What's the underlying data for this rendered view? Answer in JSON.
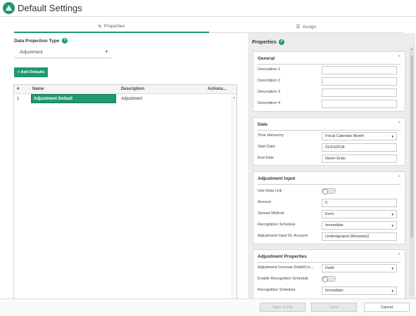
{
  "app": {
    "title": "Default Settings"
  },
  "tabs": [
    {
      "label": "Properties",
      "icon": "pencil-icon",
      "active": true
    },
    {
      "label": "Assign",
      "icon": "list-icon",
      "active": false
    }
  ],
  "projection": {
    "label": "Data Projection Type",
    "selected": "Adjustment"
  },
  "add_defaults_label": "+ Add Defaults",
  "grid": {
    "headers": [
      "#",
      "Name",
      "Description",
      "Actions..."
    ],
    "rows": [
      {
        "num": "1",
        "name": "Adjustment Default",
        "description": "Adjustment",
        "actions": ""
      }
    ]
  },
  "properties": {
    "title": "Properties",
    "general": {
      "title": "General",
      "fields": [
        {
          "label": "Description 1",
          "value": ""
        },
        {
          "label": "Description 2",
          "value": ""
        },
        {
          "label": "Description 3",
          "value": ""
        },
        {
          "label": "Description 4",
          "value": ""
        }
      ]
    },
    "date": {
      "title": "Date",
      "time_hierarchy": {
        "label": "Time Hierarchy",
        "value": "Fiscal Calendar Month"
      },
      "start_date": {
        "label": "Start Date",
        "value": "01/01/2018"
      },
      "end_date": {
        "label": "End Date",
        "value": "Never Ends"
      }
    },
    "adjustment_input": {
      "title": "Adjustment Input",
      "use_data_link": {
        "label": "Use Data Link"
      },
      "amount": {
        "label": "Amount",
        "value": "0"
      },
      "spread_method": {
        "label": "Spread Method",
        "value": "Even"
      },
      "recognition_schedule": {
        "label": "Recognition Schedule",
        "value": "Immediate"
      },
      "gl_account": {
        "label": "Adjustment Input GL Account",
        "value": "Undesignated (Monetary)"
      }
    },
    "adjustment_properties": {
      "title": "Adjustment Properties",
      "increase": {
        "label": "Adjustment Increase Debit/Cre...",
        "value": "Debit"
      },
      "enable_recognition": {
        "label": "Enable Recognition Schedule"
      },
      "recognition_schedule": {
        "label": "Recognition Schedule",
        "value": "Immediate"
      }
    }
  },
  "footer": {
    "save_exit": "Save & Exit",
    "save": "Save",
    "cancel": "Cancel"
  },
  "colors": {
    "accent": "#1e9a6c"
  }
}
